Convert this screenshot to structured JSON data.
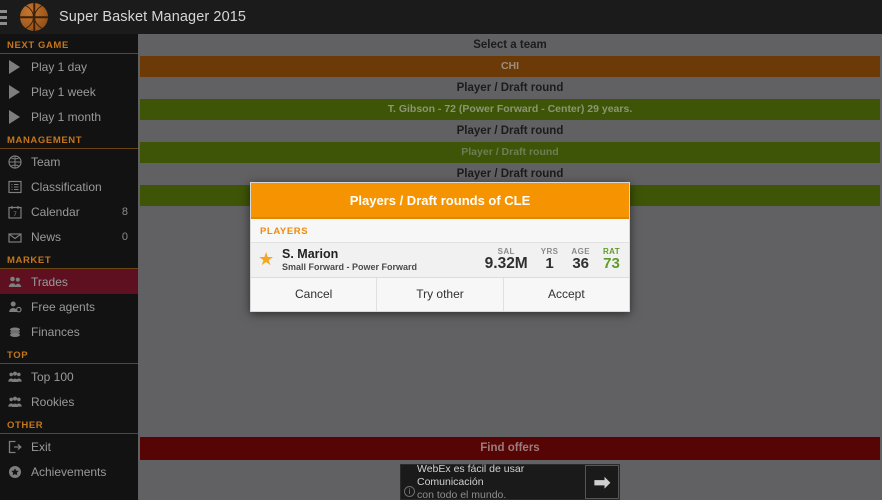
{
  "appbar": {
    "title": "Super Basket Manager 2015",
    "menu_icon": "hamburger-icon",
    "logo_icon": "basketball-logo"
  },
  "sidebar": {
    "sections": [
      {
        "label": "NEXT GAME",
        "items": [
          {
            "label": "Play 1 day",
            "icon": "play-icon",
            "count": ""
          },
          {
            "label": "Play 1 week",
            "icon": "play-icon",
            "count": ""
          },
          {
            "label": "Play 1 month",
            "icon": "play-icon",
            "count": ""
          }
        ]
      },
      {
        "label": "MANAGEMENT",
        "items": [
          {
            "label": "Team",
            "icon": "basketball-icon",
            "count": ""
          },
          {
            "label": "Classification",
            "icon": "list-icon",
            "count": ""
          },
          {
            "label": "Calendar",
            "icon": "calendar-icon",
            "count": "8"
          },
          {
            "label": "News",
            "icon": "envelope-icon",
            "count": "0"
          }
        ]
      },
      {
        "label": "MARKET",
        "items": [
          {
            "label": "Trades",
            "icon": "two-people-icon",
            "count": "",
            "active": true
          },
          {
            "label": "Free agents",
            "icon": "person-plus-icon",
            "count": ""
          },
          {
            "label": "Finances",
            "icon": "coins-icon",
            "count": ""
          }
        ]
      },
      {
        "label": "TOP",
        "items": [
          {
            "label": "Top 100",
            "icon": "group-icon",
            "count": ""
          },
          {
            "label": "Rookies",
            "icon": "group-icon",
            "count": ""
          }
        ]
      },
      {
        "label": "OTHER",
        "items": [
          {
            "label": "Exit",
            "icon": "exit-icon",
            "count": ""
          },
          {
            "label": "Achievements",
            "icon": "star-badge-icon",
            "count": ""
          }
        ]
      }
    ]
  },
  "main": {
    "rows": [
      {
        "head": "Select a team",
        "bar": "CHI",
        "bar_style": "brown"
      },
      {
        "head": "Player / Draft round",
        "bar": "T. Gibson - 72  (Power Forward - Center) 29 years.",
        "bar_style": "green"
      },
      {
        "head": "Player / Draft round",
        "bar": "Player / Draft round",
        "bar_style": "green dim"
      },
      {
        "head": "Player / Draft round",
        "bar": "",
        "bar_style": "green"
      }
    ],
    "find_offers": "Find offers"
  },
  "ad": {
    "line1": "WebEx es fácil de usar Comunicación",
    "line2": "con todo el mundo.",
    "info_icon": "info-icon",
    "arrow_icon": "arrow-right-icon",
    "arrow_glyph": "➡"
  },
  "dialog": {
    "title": "Players / Draft rounds of CLE",
    "section_label": "PLAYERS",
    "player": {
      "star_icon": "star-icon",
      "name": "S. Marion",
      "position": "Small Forward - Power Forward",
      "sal_label": "SAL",
      "sal_value": "9.32M",
      "yrs_label": "YRS",
      "yrs_value": "1",
      "age_label": "AGE",
      "age_value": "36",
      "rat_label": "RAT",
      "rat_value": "73"
    },
    "buttons": [
      {
        "label": "Cancel"
      },
      {
        "label": "Try other"
      },
      {
        "label": "Accept"
      }
    ]
  },
  "colors": {
    "accent_orange": "#f59400",
    "brand_brown": "#6b3a06",
    "bar_green": "#3e5406",
    "active_red": "#5e1020",
    "find_offers_red": "#560404",
    "rating_green": "#5f9c2a",
    "section_orange": "#c4761d"
  }
}
